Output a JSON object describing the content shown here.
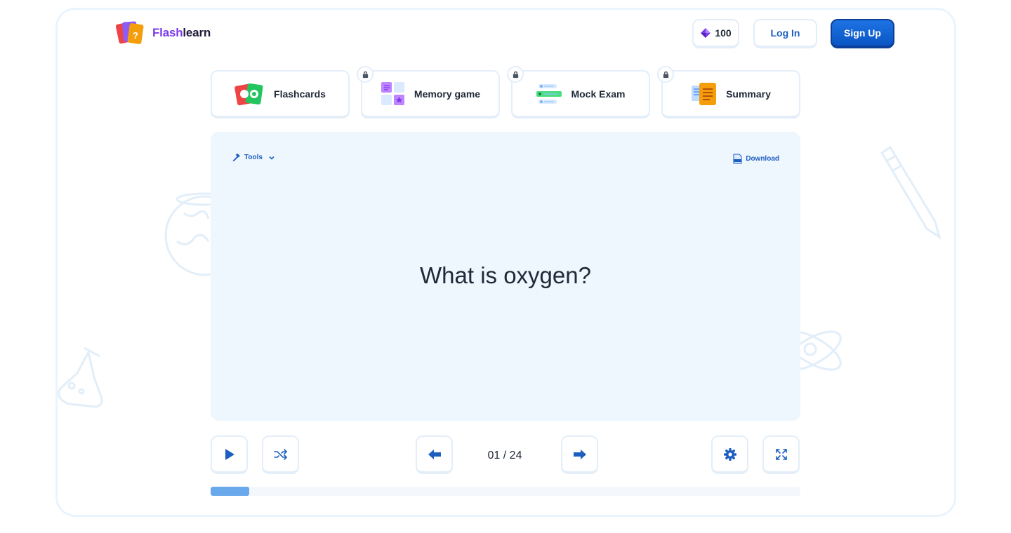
{
  "brand": {
    "name_part1": "Flash",
    "name_part2": "learn"
  },
  "header": {
    "gems_count": "100",
    "login_label": "Log In",
    "signup_label": "Sign Up"
  },
  "tabs": [
    {
      "label": "Flashcards",
      "locked": false,
      "icon": "flashcards-icon"
    },
    {
      "label": "Memory game",
      "locked": true,
      "icon": "memory-game-icon"
    },
    {
      "label": "Mock Exam",
      "locked": true,
      "icon": "mock-exam-icon"
    },
    {
      "label": "Summary",
      "locked": true,
      "icon": "summary-icon"
    }
  ],
  "card": {
    "tools_label": "Tools",
    "download_label": "Download",
    "question": "What is oxygen?"
  },
  "controls": {
    "counter": "01 / 24"
  },
  "progress": {
    "fraction": 0.065
  },
  "colors": {
    "accent": "#1d5fc1",
    "brand_purple": "#7c3aed",
    "card_bg": "#eef6fe",
    "progress": "#6aa8ec"
  }
}
